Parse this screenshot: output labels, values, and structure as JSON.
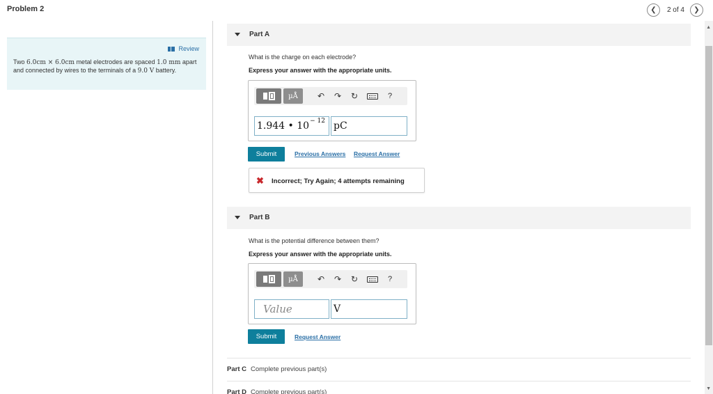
{
  "header": {
    "title": "Problem 2",
    "pager": "2 of 4",
    "prev_icon": "chevron-left-icon",
    "next_icon": "chevron-right-icon"
  },
  "problem": {
    "review_label": "Review",
    "text_parts": [
      "Two ",
      "6.0cm × 6.0cm",
      " metal electrodes are spaced ",
      "1.0 mm",
      " apart and connected by wires to the terminals of a ",
      "9.0 V",
      " battery."
    ]
  },
  "toolbar": {
    "units_label": "µÅ",
    "help_label": "?",
    "undo_icon": "undo-icon",
    "redo_icon": "redo-icon",
    "reset_icon": "reset-icon",
    "keyboard_icon": "keyboard-icon"
  },
  "partA": {
    "title": "Part A",
    "question": "What is the charge on each electrode?",
    "instruction": "Express your answer with the appropriate units.",
    "value_mantissa": "1.944 • 10",
    "value_exponent": "− 12",
    "unit_value": "pC",
    "submit_label": "Submit",
    "previous_answers_label": "Previous Answers",
    "request_answer_label": "Request Answer",
    "feedback_icon": "✖",
    "feedback_text": "Incorrect; Try Again; 4 attempts remaining"
  },
  "partB": {
    "title": "Part B",
    "question": "What is the potential difference between them?",
    "instruction": "Express your answer with the appropriate units.",
    "value_placeholder": "Value",
    "unit_value": "V",
    "submit_label": "Submit",
    "request_answer_label": "Request Answer"
  },
  "partC": {
    "label": "Part C",
    "status": "Complete previous part(s)"
  },
  "partD": {
    "label": "Part D",
    "status": "Complete previous part(s)"
  }
}
